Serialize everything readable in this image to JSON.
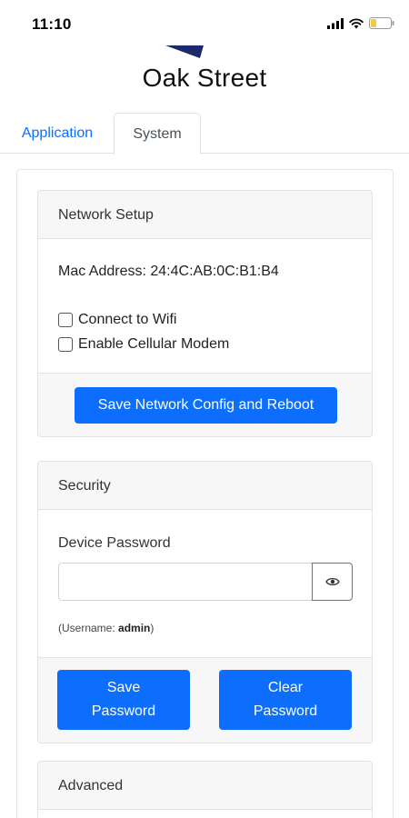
{
  "status_bar": {
    "time": "11:10",
    "icons": [
      "signal-icon",
      "wifi-icon",
      "battery-icon"
    ]
  },
  "header": {
    "title": "Oak Street",
    "logo": "logo-mark"
  },
  "tabs": [
    {
      "label": "Application",
      "active": false
    },
    {
      "label": "System",
      "active": true
    }
  ],
  "network_setup": {
    "header": "Network Setup",
    "mac_address_label": "Mac Address: 24:4C:AB:0C:B1:B4",
    "wifi_label": "Connect to Wifi",
    "wifi_checked": false,
    "modem_label": "Enable Cellular Modem",
    "modem_checked": false,
    "save_button": "Save Network Config and Reboot"
  },
  "security": {
    "header": "Security",
    "password_label": "Device Password",
    "password_value": "",
    "username_prefix": "(Username: ",
    "username": "admin",
    "username_suffix": ")",
    "save_button_line1": "Save",
    "save_button_line2": "Password",
    "clear_button_line1": "Clear",
    "clear_button_line2": "Password"
  },
  "advanced": {
    "header": "Advanced"
  },
  "colors": {
    "accent": "#0d6efd",
    "card_header_bg": "#f7f7f7",
    "border": "#dfe2e6"
  }
}
